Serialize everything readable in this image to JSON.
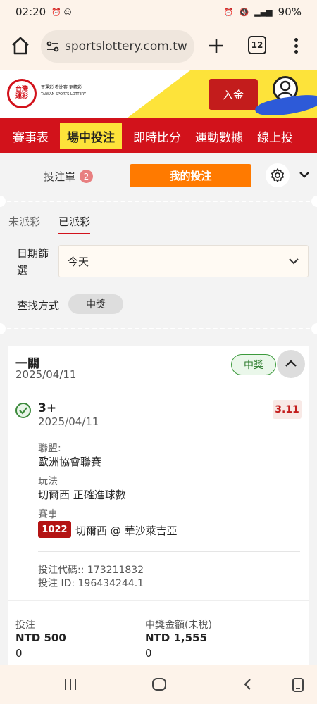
{
  "status_bar": {
    "time": "02:20",
    "battery": "90%"
  },
  "browser": {
    "url": "sportslottery.com.tw",
    "tab_count": "12"
  },
  "site_header": {
    "logo_line1": "台灣",
    "logo_line2": "運彩",
    "tagline": "買運彩 看比賽 更精彩",
    "tagline_en": "TAIWAN SPORTS LOTTERY",
    "deposit_label": "入金"
  },
  "nav": {
    "items": [
      "賽事表",
      "場中投注",
      "即時比分",
      "運動數據",
      "線上投"
    ],
    "active_index": 1
  },
  "bet_slip": {
    "slip_label": "投注單",
    "slip_count": "2",
    "my_bets_label": "我的投注"
  },
  "settle_tabs": {
    "unsettled": "未派彩",
    "settled": "已派彩"
  },
  "filters": {
    "date_label": "日期篩選",
    "date_value": "今天",
    "find_label": "查找方式",
    "find_value": "中獎"
  },
  "bet_card": {
    "title": "一關",
    "date": "2025/04/11",
    "status": "中獎",
    "selection": "3+",
    "selection_date": "2025/04/11",
    "odds": "3.11",
    "league_label": "聯盟:",
    "league": "歐洲協會聯賽",
    "market_label": "玩法",
    "market": "切爾西 正確進球數",
    "event_label": "賽事",
    "match_id": "1022",
    "match_name": "切爾西 @ 華沙萊吉亞",
    "bet_code": "投注代碼:: 173211832",
    "bet_id": "投注 ID: 196434244.1"
  },
  "summary": {
    "stake_label": "投注",
    "stake_value": "NTD 500",
    "stake_sub": "0",
    "payout_label": "中獎金額(未稅)",
    "payout_value": "NTD 1,555",
    "payout_sub": "0"
  }
}
